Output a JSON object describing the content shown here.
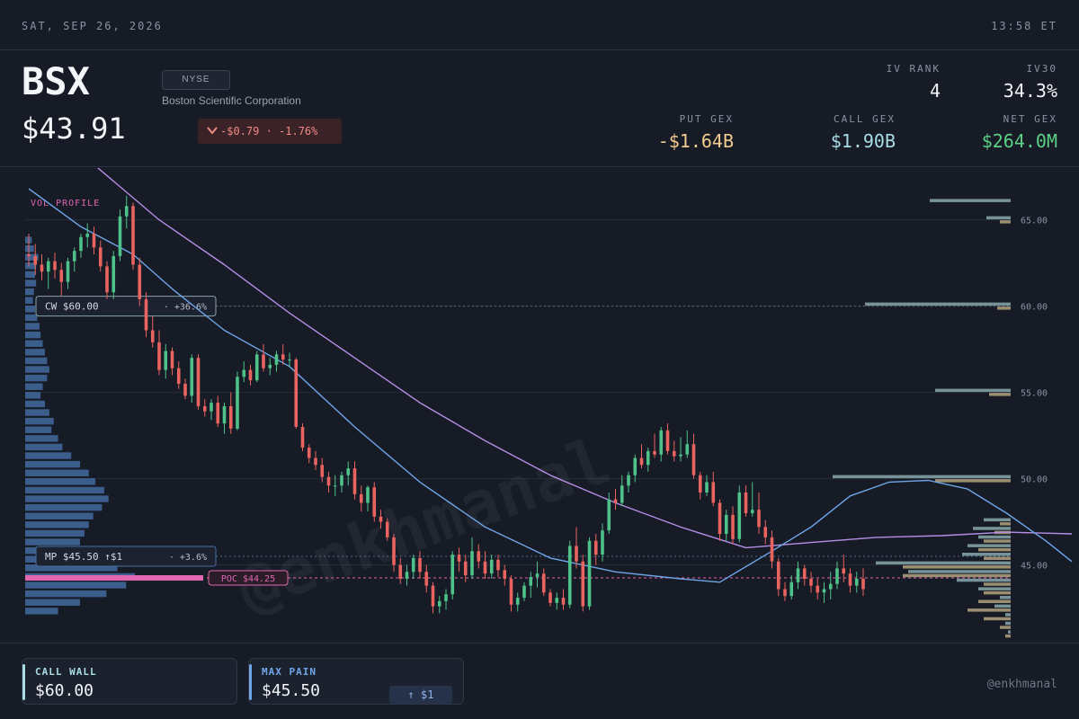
{
  "top": {
    "date": "SAT, SEP 26, 2026",
    "time": "13:58 ET"
  },
  "header": {
    "ticker": "BSX",
    "exchange": "NYSE",
    "company": "Boston Scientific Corporation",
    "price": "$43.91",
    "change": "-$0.79 · -1.76%",
    "iv_rank_label": "IV RANK",
    "iv_rank": "4",
    "iv30_label": "IV30",
    "iv30": "34.3%",
    "put_gex_label": "PUT GEX",
    "put_gex": "-$1.64B",
    "call_gex_label": "CALL GEX",
    "call_gex": "$1.90B",
    "net_gex_label": "NET GEX",
    "net_gex": "$264.0M"
  },
  "colors": {
    "background": "#161b26",
    "up": "#4fc28a",
    "down": "#e9635f",
    "ma_fast": "#6fa6e8",
    "ma_slow": "#b48ee6",
    "poc": "#e067b0",
    "put_gex": "#f2cc8f",
    "call_gex": "#a9dde6",
    "net_gex": "#5ccf86",
    "vol_profile": "#4a76b0",
    "gex_call_bar": "#8aa8ad",
    "gex_put_bar": "#b3a27f"
  },
  "footer": {
    "call_wall_label": "CALL WALL",
    "call_wall": "$60.00",
    "max_pain_label": "MAX PAIN",
    "max_pain": "$45.50",
    "max_pain_badge": "↑ $1",
    "handle": "@enkhmanal"
  },
  "chart_data": {
    "type": "candlestick",
    "ylim": [
      40.5,
      68.0
    ],
    "yticks": [
      45,
      50,
      55,
      60,
      65
    ],
    "ytick_labels": [
      "45.00",
      "50.00",
      "55.00",
      "60.00",
      "65.00"
    ],
    "vol_profile_label": "VOL PROFILE",
    "watermark": "@enkhmanal",
    "levels": [
      {
        "name": "call-wall",
        "price": 60.0,
        "label": "CW $60.00",
        "pct": "+36.6%",
        "style": "gray"
      },
      {
        "name": "max-pain",
        "price": 45.5,
        "label": "MP $45.50 ↑$1",
        "pct": "+3.6%",
        "style": "blue"
      },
      {
        "name": "poc",
        "price": 44.25,
        "label": "POC $44.25",
        "style": "pink"
      }
    ],
    "candles": [
      [
        63.0,
        64.2,
        62.3,
        62.9
      ],
      [
        62.9,
        63.6,
        61.8,
        62.4
      ],
      [
        62.4,
        63.0,
        61.5,
        62.0
      ],
      [
        62.0,
        62.8,
        61.0,
        62.6
      ],
      [
        62.6,
        63.1,
        61.6,
        62.1
      ],
      [
        62.1,
        62.5,
        60.6,
        61.4
      ],
      [
        61.4,
        62.8,
        61.0,
        62.6
      ],
      [
        62.6,
        63.4,
        62.0,
        63.2
      ],
      [
        63.2,
        64.2,
        62.8,
        64.0
      ],
      [
        64.0,
        64.8,
        63.4,
        64.2
      ],
      [
        64.2,
        64.6,
        63.0,
        63.4
      ],
      [
        63.4,
        63.8,
        62.0,
        62.3
      ],
      [
        62.3,
        62.6,
        60.4,
        60.8
      ],
      [
        60.8,
        63.2,
        60.4,
        62.9
      ],
      [
        62.9,
        65.6,
        62.6,
        65.2
      ],
      [
        65.2,
        66.4,
        64.5,
        65.8
      ],
      [
        65.8,
        66.0,
        62.1,
        62.4
      ],
      [
        62.4,
        62.8,
        60.0,
        60.4
      ],
      [
        60.4,
        60.8,
        58.2,
        58.6
      ],
      [
        58.6,
        59.4,
        57.6,
        57.9
      ],
      [
        57.9,
        58.6,
        56.0,
        56.3
      ],
      [
        56.3,
        57.8,
        55.8,
        57.4
      ],
      [
        57.4,
        57.6,
        56.0,
        56.4
      ],
      [
        56.4,
        56.8,
        55.2,
        55.5
      ],
      [
        55.5,
        55.8,
        54.6,
        54.8
      ],
      [
        54.8,
        57.2,
        54.4,
        57.0
      ],
      [
        57.0,
        57.2,
        54.0,
        54.2
      ],
      [
        54.2,
        54.6,
        53.6,
        53.9
      ],
      [
        53.9,
        54.6,
        53.4,
        54.4
      ],
      [
        54.4,
        54.8,
        53.0,
        53.2
      ],
      [
        53.2,
        54.4,
        52.6,
        54.2
      ],
      [
        54.2,
        55.0,
        52.6,
        52.9
      ],
      [
        52.9,
        56.2,
        52.8,
        55.9
      ],
      [
        55.9,
        56.8,
        55.6,
        56.3
      ],
      [
        56.3,
        56.6,
        55.4,
        55.7
      ],
      [
        55.7,
        57.4,
        55.6,
        57.2
      ],
      [
        57.2,
        57.8,
        56.2,
        56.4
      ],
      [
        56.4,
        57.0,
        56.0,
        56.6
      ],
      [
        56.6,
        57.4,
        56.2,
        57.2
      ],
      [
        57.2,
        57.8,
        56.6,
        56.9
      ],
      [
        56.9,
        57.3,
        56.5,
        56.9
      ],
      [
        56.9,
        57.0,
        52.9,
        53.0
      ],
      [
        53.0,
        53.2,
        51.6,
        51.8
      ],
      [
        51.8,
        52.0,
        50.9,
        51.2
      ],
      [
        51.2,
        51.6,
        50.5,
        50.8
      ],
      [
        50.8,
        51.2,
        49.8,
        50.1
      ],
      [
        50.1,
        50.4,
        49.2,
        49.6
      ],
      [
        49.6,
        50.2,
        49.0,
        49.6
      ],
      [
        49.6,
        50.4,
        49.2,
        50.2
      ],
      [
        50.2,
        51.0,
        49.6,
        50.6
      ],
      [
        50.6,
        51.0,
        48.8,
        49.1
      ],
      [
        49.1,
        49.6,
        48.1,
        48.6
      ],
      [
        48.6,
        49.6,
        48.1,
        49.5
      ],
      [
        49.5,
        49.8,
        47.5,
        47.8
      ],
      [
        47.8,
        48.2,
        47.1,
        47.5
      ],
      [
        47.5,
        47.7,
        46.4,
        46.6
      ],
      [
        46.6,
        46.8,
        44.6,
        45.0
      ],
      [
        45.0,
        45.4,
        43.9,
        44.2
      ],
      [
        44.2,
        45.0,
        43.8,
        44.6
      ],
      [
        44.6,
        45.6,
        44.2,
        45.4
      ],
      [
        45.4,
        45.8,
        44.2,
        44.6
      ],
      [
        44.6,
        45.0,
        43.4,
        43.8
      ],
      [
        43.8,
        44.0,
        42.2,
        42.6
      ],
      [
        42.6,
        43.2,
        42.2,
        42.9
      ],
      [
        42.9,
        43.6,
        42.4,
        43.3
      ],
      [
        43.3,
        45.8,
        43.0,
        45.6
      ],
      [
        45.6,
        46.0,
        44.6,
        45.2
      ],
      [
        45.2,
        45.6,
        44.0,
        44.4
      ],
      [
        44.4,
        46.6,
        44.2,
        45.8
      ],
      [
        45.8,
        46.2,
        44.8,
        45.2
      ],
      [
        45.2,
        45.8,
        44.2,
        44.5
      ],
      [
        44.5,
        45.6,
        44.2,
        45.3
      ],
      [
        45.3,
        45.6,
        44.3,
        44.7
      ],
      [
        44.7,
        45.0,
        43.8,
        44.2
      ],
      [
        44.2,
        44.4,
        42.3,
        42.7
      ],
      [
        42.7,
        43.4,
        42.3,
        43.1
      ],
      [
        43.1,
        44.0,
        42.9,
        43.8
      ],
      [
        43.8,
        44.6,
        43.1,
        44.3
      ],
      [
        44.3,
        45.2,
        43.7,
        44.5
      ],
      [
        44.5,
        44.8,
        43.2,
        43.4
      ],
      [
        43.4,
        43.6,
        42.6,
        42.8
      ],
      [
        42.8,
        43.4,
        42.4,
        43.1
      ],
      [
        43.1,
        43.6,
        42.4,
        42.7
      ],
      [
        42.7,
        46.4,
        42.5,
        46.1
      ],
      [
        46.1,
        47.2,
        44.8,
        45.2
      ],
      [
        45.2,
        45.6,
        42.3,
        42.6
      ],
      [
        42.6,
        46.6,
        42.4,
        46.4
      ],
      [
        46.4,
        46.8,
        45.0,
        45.6
      ],
      [
        45.6,
        47.4,
        45.2,
        47.0
      ],
      [
        47.0,
        49.2,
        46.8,
        48.8
      ],
      [
        48.8,
        49.4,
        48.2,
        48.6
      ],
      [
        48.6,
        50.2,
        48.4,
        49.6
      ],
      [
        49.6,
        50.4,
        49.2,
        50.2
      ],
      [
        50.2,
        51.4,
        49.8,
        51.2
      ],
      [
        51.2,
        52.0,
        50.6,
        50.8
      ],
      [
        50.8,
        51.8,
        50.4,
        51.6
      ],
      [
        51.6,
        52.6,
        51.2,
        51.4
      ],
      [
        51.4,
        53.0,
        51.0,
        52.8
      ],
      [
        52.8,
        53.2,
        51.4,
        51.6
      ],
      [
        51.6,
        52.2,
        51.0,
        51.3
      ],
      [
        51.3,
        52.4,
        51.0,
        51.4
      ],
      [
        51.4,
        52.8,
        51.2,
        52.0
      ],
      [
        52.0,
        52.6,
        50.0,
        50.2
      ],
      [
        50.2,
        50.4,
        48.8,
        49.2
      ],
      [
        49.2,
        50.2,
        49.0,
        49.8
      ],
      [
        49.8,
        50.4,
        48.4,
        48.6
      ],
      [
        48.6,
        48.8,
        46.4,
        46.8
      ],
      [
        46.8,
        48.2,
        46.4,
        47.9
      ],
      [
        47.9,
        48.4,
        46.2,
        46.5
      ],
      [
        46.5,
        49.6,
        46.3,
        49.2
      ],
      [
        49.2,
        49.6,
        47.8,
        48.0
      ],
      [
        48.0,
        49.8,
        47.8,
        48.2
      ],
      [
        48.2,
        49.2,
        46.8,
        47.2
      ],
      [
        47.2,
        47.6,
        46.2,
        46.6
      ],
      [
        46.6,
        47.0,
        44.8,
        45.2
      ],
      [
        45.2,
        45.4,
        43.2,
        43.6
      ],
      [
        43.6,
        44.0,
        42.9,
        43.2
      ],
      [
        43.2,
        44.4,
        43.0,
        44.0
      ],
      [
        44.0,
        45.2,
        43.6,
        44.8
      ],
      [
        44.8,
        45.0,
        43.8,
        44.2
      ],
      [
        44.2,
        44.6,
        43.4,
        43.8
      ],
      [
        43.8,
        44.2,
        43.0,
        43.4
      ],
      [
        43.4,
        44.0,
        42.8,
        43.6
      ],
      [
        43.6,
        44.6,
        43.0,
        43.9
      ],
      [
        43.9,
        45.2,
        43.6,
        44.8
      ],
      [
        44.8,
        45.6,
        44.0,
        44.5
      ],
      [
        44.5,
        44.8,
        43.4,
        43.8
      ],
      [
        43.8,
        44.6,
        43.4,
        44.2
      ],
      [
        44.2,
        44.8,
        43.2,
        43.6
      ]
    ],
    "ma_fast": [
      [
        0,
        66.8
      ],
      [
        8,
        64.6
      ],
      [
        16,
        63.0
      ],
      [
        22,
        61.0
      ],
      [
        30,
        58.6
      ],
      [
        40,
        56.5
      ],
      [
        50,
        53.0
      ],
      [
        60,
        49.8
      ],
      [
        70,
        47.2
      ],
      [
        80,
        45.4
      ],
      [
        90,
        44.6
      ],
      [
        100,
        44.2
      ],
      [
        106,
        44.0
      ],
      [
        114,
        45.8
      ],
      [
        120,
        47.2
      ],
      [
        126,
        49.0
      ],
      [
        132,
        49.8
      ],
      [
        138,
        49.9
      ],
      [
        144,
        49.4
      ],
      [
        150,
        48.0
      ],
      [
        156,
        46.4
      ],
      [
        160,
        45.2
      ]
    ],
    "ma_slow": [
      [
        0,
        71.2
      ],
      [
        10,
        68.2
      ],
      [
        20,
        65.0
      ],
      [
        30,
        62.4
      ],
      [
        40,
        59.6
      ],
      [
        50,
        57.0
      ],
      [
        60,
        54.4
      ],
      [
        70,
        52.2
      ],
      [
        80,
        50.2
      ],
      [
        90,
        48.6
      ],
      [
        100,
        47.2
      ],
      [
        110,
        46.0
      ],
      [
        120,
        46.3
      ],
      [
        130,
        46.6
      ],
      [
        140,
        46.7
      ],
      [
        150,
        46.9
      ],
      [
        160,
        46.8
      ]
    ],
    "vol_profile": [
      [
        63.8,
        0.06
      ],
      [
        63.3,
        0.08
      ],
      [
        62.8,
        0.12
      ],
      [
        62.3,
        0.1
      ],
      [
        61.8,
        0.09
      ],
      [
        61.3,
        0.1
      ],
      [
        60.8,
        0.08
      ],
      [
        60.3,
        0.07
      ],
      [
        59.8,
        0.09
      ],
      [
        59.3,
        0.11
      ],
      [
        58.8,
        0.13
      ],
      [
        58.3,
        0.14
      ],
      [
        57.8,
        0.16
      ],
      [
        57.3,
        0.18
      ],
      [
        56.8,
        0.2
      ],
      [
        56.3,
        0.22
      ],
      [
        55.8,
        0.2
      ],
      [
        55.3,
        0.16
      ],
      [
        54.8,
        0.14
      ],
      [
        54.3,
        0.18
      ],
      [
        53.8,
        0.22
      ],
      [
        53.3,
        0.26
      ],
      [
        52.8,
        0.24
      ],
      [
        52.3,
        0.3
      ],
      [
        51.8,
        0.34
      ],
      [
        51.3,
        0.42
      ],
      [
        50.8,
        0.5
      ],
      [
        50.3,
        0.58
      ],
      [
        49.8,
        0.64
      ],
      [
        49.3,
        0.72
      ],
      [
        48.8,
        0.76
      ],
      [
        48.3,
        0.7
      ],
      [
        47.8,
        0.62
      ],
      [
        47.3,
        0.58
      ],
      [
        46.8,
        0.54
      ],
      [
        46.3,
        0.5
      ],
      [
        45.8,
        0.56
      ],
      [
        45.3,
        0.7
      ],
      [
        44.8,
        0.84
      ],
      [
        44.3,
        1.0
      ],
      [
        43.8,
        0.92
      ],
      [
        43.3,
        0.74
      ],
      [
        42.8,
        0.5
      ],
      [
        42.3,
        0.3
      ]
    ],
    "gex_bars": [
      {
        "price": 66.0,
        "call": 0.3,
        "put": 0
      },
      {
        "price": 65.0,
        "call": 0.09,
        "put": 0.04
      },
      {
        "price": 60.0,
        "call": 0.54,
        "put": 0.05
      },
      {
        "price": 55.0,
        "call": 0.28,
        "put": 0.08
      },
      {
        "price": 50.0,
        "call": 0.66,
        "put": 0.28
      },
      {
        "price": 47.5,
        "call": 0.1,
        "put": 0.04
      },
      {
        "price": 47.0,
        "call": 0.14,
        "put": 0.06
      },
      {
        "price": 46.5,
        "call": 0.12,
        "put": 0.1
      },
      {
        "price": 46.0,
        "call": 0.16,
        "put": 0.12
      },
      {
        "price": 45.5,
        "call": 0.18,
        "put": 0.1
      },
      {
        "price": 45.0,
        "call": 0.5,
        "put": 0.4
      },
      {
        "price": 44.5,
        "call": 0.38,
        "put": 0.4
      },
      {
        "price": 44.0,
        "call": 0.2,
        "put": 0.1
      },
      {
        "price": 43.5,
        "call": 0.12,
        "put": 0.1
      },
      {
        "price": 43.0,
        "call": 0.04,
        "put": 0.12
      },
      {
        "price": 42.5,
        "call": 0.06,
        "put": 0.16
      },
      {
        "price": 42.0,
        "call": 0.02,
        "put": 0.1
      },
      {
        "price": 41.5,
        "call": 0.02,
        "put": 0.04
      },
      {
        "price": 41.0,
        "call": 0.01,
        "put": 0.02
      }
    ]
  }
}
